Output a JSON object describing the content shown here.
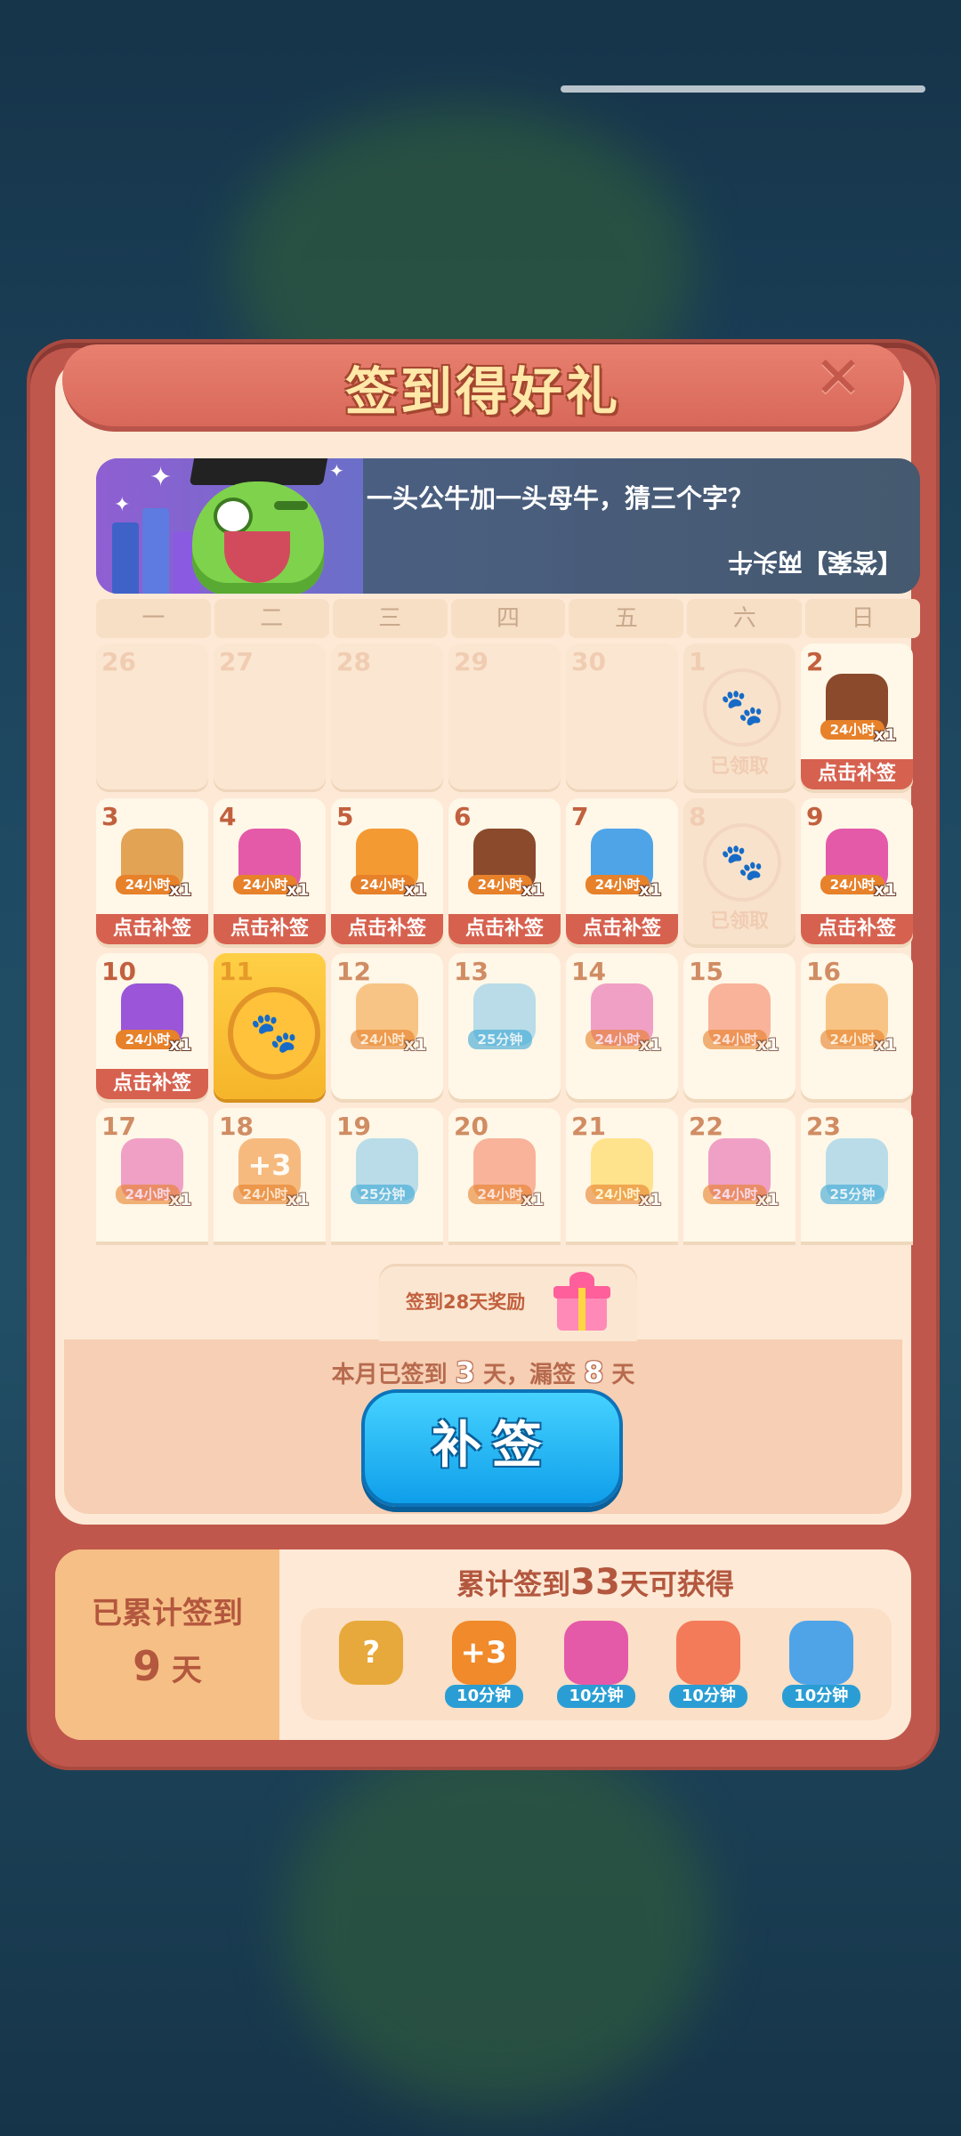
{
  "modal": {
    "title": "签到得好礼",
    "close_icon": "close-icon"
  },
  "riddle": {
    "question": "一头公牛加一头母牛，猜三个字？",
    "answer": "【答案】两头牛"
  },
  "weekdays": [
    "一",
    "二",
    "三",
    "四",
    "五",
    "六",
    "日"
  ],
  "calendar": [
    {
      "day": "26",
      "state": "empty"
    },
    {
      "day": "27",
      "state": "empty"
    },
    {
      "day": "28",
      "state": "empty"
    },
    {
      "day": "29",
      "state": "empty"
    },
    {
      "day": "30",
      "state": "empty"
    },
    {
      "day": "1",
      "state": "claimed",
      "label": "已领取"
    },
    {
      "day": "2",
      "state": "missed",
      "reward": "board-booster",
      "tag": "24小时",
      "qty": "x1",
      "button": "点击补签",
      "color": "#8a4a2b"
    },
    {
      "day": "3",
      "state": "missed",
      "reward": "hammer",
      "tag": "24小时",
      "qty": "x1",
      "button": "点击补签",
      "color": "#e2a354"
    },
    {
      "day": "4",
      "state": "missed",
      "reward": "rainbow-owl",
      "tag": "24小时",
      "qty": "x1",
      "button": "点击补签",
      "color": "#e45aa8"
    },
    {
      "day": "5",
      "state": "missed",
      "reward": "clock",
      "tag": "24小时",
      "qty": "x1",
      "button": "点击补签",
      "color": "#f39a33"
    },
    {
      "day": "6",
      "state": "missed",
      "reward": "board-booster",
      "tag": "24小时",
      "qty": "x1",
      "button": "点击补签",
      "color": "#8a4a2b"
    },
    {
      "day": "7",
      "state": "missed",
      "reward": "blue-chick",
      "tag": "24小时",
      "qty": "x1",
      "button": "点击补签",
      "color": "#4fa4e8"
    },
    {
      "day": "8",
      "state": "claimed",
      "label": "已领取"
    },
    {
      "day": "9",
      "state": "missed",
      "reward": "rainbow-owl",
      "tag": "24小时",
      "qty": "x1",
      "button": "点击补签",
      "color": "#e45aa8"
    },
    {
      "day": "10",
      "state": "missed",
      "reward": "purple-chick",
      "tag": "24小时",
      "qty": "x1",
      "button": "点击补签",
      "color": "#9a55d8"
    },
    {
      "day": "11",
      "state": "today"
    },
    {
      "day": "12",
      "state": "future",
      "reward": "clock",
      "tag": "24小时",
      "qty": "x1",
      "color": "#f39a33"
    },
    {
      "day": "13",
      "state": "future",
      "reward": "bottle",
      "tag": "25分钟",
      "tag_type": "time",
      "color": "#7fc7e8"
    },
    {
      "day": "14",
      "state": "future",
      "reward": "rainbow-owl",
      "tag": "24小时",
      "qty": "x1",
      "color": "#e45aa8"
    },
    {
      "day": "15",
      "state": "future",
      "reward": "rockets",
      "tag": "24小时",
      "qty": "x1",
      "color": "#f37b5a"
    },
    {
      "day": "16",
      "state": "future",
      "reward": "clock",
      "tag": "24小时",
      "qty": "x1",
      "color": "#f39a33"
    },
    {
      "day": "17",
      "state": "future",
      "reward": "rainbow-owl",
      "tag": "24小时",
      "qty": "x1",
      "color": "#e45aa8"
    },
    {
      "day": "18",
      "state": "future",
      "reward": "plus-three",
      "tag": "24小时",
      "qty": "x1",
      "color": "#f08a2b",
      "art_text": "+3"
    },
    {
      "day": "19",
      "state": "future",
      "reward": "bottle",
      "tag": "25分钟",
      "tag_type": "time",
      "color": "#7fc7e8"
    },
    {
      "day": "20",
      "state": "future",
      "reward": "rockets",
      "tag": "24小时",
      "qty": "x1",
      "color": "#f37b5a"
    },
    {
      "day": "21",
      "state": "future",
      "reward": "star",
      "tag": "24小时",
      "qty": "x1",
      "color": "#ffd23f"
    },
    {
      "day": "22",
      "state": "future",
      "reward": "rainbow-owl",
      "tag": "24小时",
      "qty": "x1",
      "color": "#e45aa8"
    },
    {
      "day": "23",
      "state": "future",
      "reward": "bottle",
      "tag": "25分钟",
      "tag_type": "time",
      "color": "#7fc7e8"
    }
  ],
  "bonus": {
    "label": "签到28天奖励",
    "icon": "gift-icon"
  },
  "stats": {
    "prefix": "本月已签到",
    "signed": "3",
    "middle": "天，漏签",
    "missed": "8",
    "suffix": "天"
  },
  "makeup_button": "补签",
  "cumulative": {
    "label": "已累计签到",
    "days": "9",
    "days_unit": "天",
    "title_prefix": "累计签到",
    "title_days": "33",
    "title_suffix": "天可获得",
    "rewards": [
      {
        "name": "mystery-trophy",
        "color": "#e7a93b",
        "art_text": "?"
      },
      {
        "name": "plus-three",
        "tag": "10分钟",
        "color": "#f08a2b",
        "art_text": "+3"
      },
      {
        "name": "rainbow-owl",
        "tag": "10分钟",
        "color": "#e45aa8"
      },
      {
        "name": "rockets",
        "tag": "10分钟",
        "color": "#f37b5a"
      },
      {
        "name": "blue-chick",
        "tag": "10分钟",
        "color": "#4fa4e8"
      }
    ]
  }
}
